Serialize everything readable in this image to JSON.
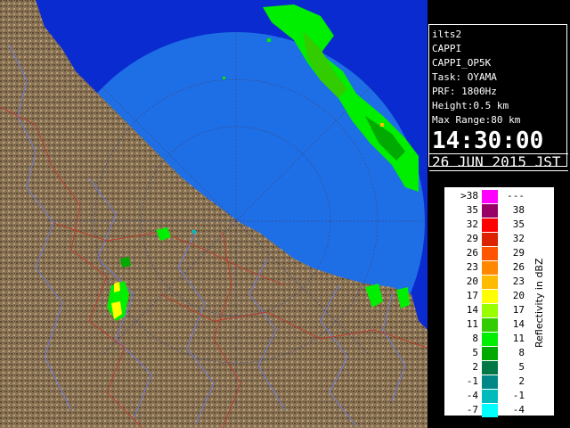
{
  "radar": {
    "site": "ilts2",
    "product": "CAPPI",
    "product_id": "CAPPI_OP5K",
    "task": "Task: OYAMA",
    "prf": "PRF: 1800Hz",
    "height": "Height:0.5 km",
    "max_range": "Max Range:80 km",
    "time": "14:30:00",
    "date": "26 JUN 2015 JST"
  },
  "legend": {
    "unit": "Reflectivity in dBZ",
    "rows": [
      {
        "lo": ">38",
        "hi": "---",
        "color": "#ff00ff"
      },
      {
        "lo": "35",
        "hi": "38",
        "color": "#990066"
      },
      {
        "lo": "32",
        "hi": "35",
        "color": "#ff0000"
      },
      {
        "lo": "29",
        "hi": "32",
        "color": "#dd2200"
      },
      {
        "lo": "26",
        "hi": "29",
        "color": "#ff5500"
      },
      {
        "lo": "23",
        "hi": "26",
        "color": "#ff8800"
      },
      {
        "lo": "20",
        "hi": "23",
        "color": "#ffbb00"
      },
      {
        "lo": "17",
        "hi": "20",
        "color": "#ffff00"
      },
      {
        "lo": "14",
        "hi": "17",
        "color": "#99ff00"
      },
      {
        "lo": "11",
        "hi": "14",
        "color": "#33cc00"
      },
      {
        "lo": "8",
        "hi": "11",
        "color": "#00ee00"
      },
      {
        "lo": "5",
        "hi": "8",
        "color": "#00aa00"
      },
      {
        "lo": "2",
        "hi": "5",
        "color": "#007744"
      },
      {
        "lo": "-1",
        "hi": "2",
        "color": "#008888"
      },
      {
        "lo": "-4",
        "hi": "-1",
        "color": "#00bbbb"
      },
      {
        "lo": "-7",
        "hi": "-4",
        "color": "#00ffff"
      }
    ]
  },
  "colors": {
    "sea_in_range": "#1e6fe6",
    "sea_out_range": "#0a2bd0",
    "land": "#8a7355",
    "rivers": "#6b7bd6",
    "boundaries": "#c0392b"
  }
}
